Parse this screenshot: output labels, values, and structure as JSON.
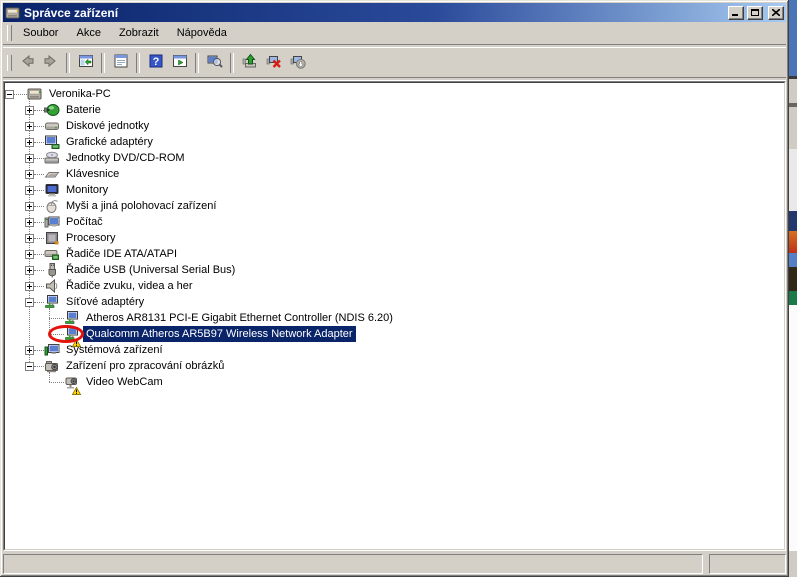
{
  "window": {
    "title": "Správce zařízení",
    "controls": [
      "minimize",
      "maximize",
      "close"
    ]
  },
  "menu": {
    "items": [
      "Soubor",
      "Akce",
      "Zobrazit",
      "Nápověda"
    ]
  },
  "toolbar": {
    "buttons": [
      {
        "icon": "back-arrow",
        "disabled": true
      },
      {
        "icon": "forward-arrow",
        "disabled": true
      },
      {
        "separator": true
      },
      {
        "icon": "show-console-tree"
      },
      {
        "separator": true
      },
      {
        "icon": "properties-window"
      },
      {
        "separator": true
      },
      {
        "icon": "help"
      },
      {
        "icon": "show-action-pane"
      },
      {
        "separator": true
      },
      {
        "icon": "scan-computer"
      },
      {
        "separator": true
      },
      {
        "icon": "update-driver"
      },
      {
        "icon": "uninstall-device"
      },
      {
        "icon": "scan-hardware-changes"
      }
    ]
  },
  "tree": {
    "items": [
      {
        "label": "Veronika-PC",
        "level": 0,
        "expand": "minus",
        "icon": "computer"
      },
      {
        "label": "Baterie",
        "level": 1,
        "expand": "plus",
        "icon": "battery"
      },
      {
        "label": "Diskové jednotky",
        "level": 1,
        "expand": "plus",
        "icon": "disk-drive"
      },
      {
        "label": "Grafické adaptéry",
        "level": 1,
        "expand": "plus",
        "icon": "display-adapter"
      },
      {
        "label": "Jednotky DVD/CD-ROM",
        "level": 1,
        "expand": "plus",
        "icon": "dvd-drive"
      },
      {
        "label": "Klávesnice",
        "level": 1,
        "expand": "plus",
        "icon": "keyboard"
      },
      {
        "label": "Monitory",
        "level": 1,
        "expand": "plus",
        "icon": "monitor"
      },
      {
        "label": "Myši a jiná polohovací zařízení",
        "level": 1,
        "expand": "plus",
        "icon": "mouse"
      },
      {
        "label": "Počítač",
        "level": 1,
        "expand": "plus",
        "icon": "computer-device"
      },
      {
        "label": "Procesory",
        "level": 1,
        "expand": "plus",
        "icon": "processor"
      },
      {
        "label": "Řadiče IDE ATA/ATAPI",
        "level": 1,
        "expand": "plus",
        "icon": "ide-controller"
      },
      {
        "label": "Řadiče USB (Universal Serial Bus)",
        "level": 1,
        "expand": "plus",
        "icon": "usb-controller"
      },
      {
        "label": "Řadiče zvuku, videa a her",
        "level": 1,
        "expand": "plus",
        "icon": "sound-controller"
      },
      {
        "label": "Síťové adaptéry",
        "level": 1,
        "expand": "minus",
        "icon": "network-adapter"
      },
      {
        "label": "Atheros AR8131 PCI-E Gigabit Ethernet Controller (NDIS 6.20)",
        "level": 2,
        "expand": "none",
        "icon": "network-adapter"
      },
      {
        "label": "Qualcomm Atheros AR5B97 Wireless Network Adapter",
        "level": 2,
        "expand": "none",
        "icon": "network-adapter",
        "selected": true,
        "warning": true,
        "annotated": true
      },
      {
        "label": "Systémová zařízení",
        "level": 1,
        "expand": "plus",
        "icon": "system-device"
      },
      {
        "label": "Zařízení pro zpracování obrázků",
        "level": 1,
        "expand": "minus",
        "icon": "imaging-device"
      },
      {
        "label": "Video WebCam",
        "level": 2,
        "expand": "none",
        "icon": "webcam",
        "warning": true
      }
    ]
  },
  "statusbar": {
    "left": "",
    "right": ""
  },
  "colors": {
    "titlebar_left": "#0a246a",
    "titlebar_right": "#a6caf0",
    "chrome": "#d4d0c8",
    "selection_bg": "#0a246a",
    "selection_text": "#ffffff",
    "tree_bg": "#ffffff",
    "warning_yellow": "#ffd800",
    "annotation_red": "#e3120b"
  }
}
